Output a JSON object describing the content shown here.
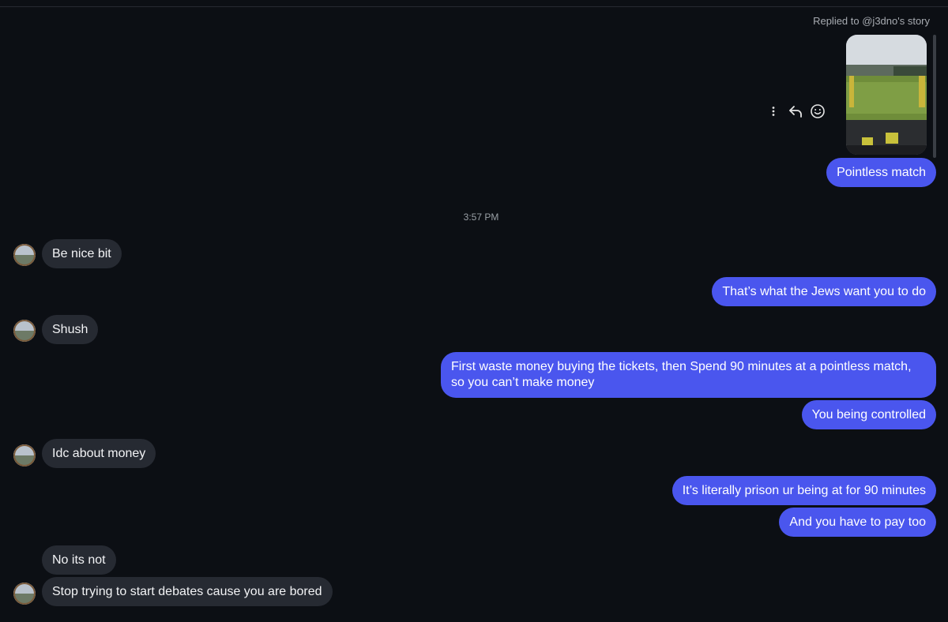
{
  "header": {
    "replied_label": "Replied to @j3dno's story"
  },
  "story": {
    "image_alt": "football stadium photo"
  },
  "actions": {
    "more_icon": "more-vertical-icon",
    "reply_icon": "reply-icon",
    "react_icon": "smiley-icon"
  },
  "timestamp": "3:57 PM",
  "messages": [
    {
      "side": "out",
      "text": "Pointless match"
    },
    {
      "side": "in",
      "text": "Be nice bit"
    },
    {
      "side": "out",
      "text": "That’s what the Jews want you to do"
    },
    {
      "side": "in",
      "text": "Shush"
    },
    {
      "side": "out",
      "text": "First waste money buying the tickets, then Spend 90 minutes at a pointless match, so you can’t make money"
    },
    {
      "side": "out",
      "text": "You being controlled"
    },
    {
      "side": "in",
      "text": "Idc about money"
    },
    {
      "side": "out",
      "text": "It’s literally prison ur being at for 90 minutes"
    },
    {
      "side": "out",
      "text": "And you have to pay too"
    },
    {
      "side": "in",
      "text": "No its not"
    },
    {
      "side": "in",
      "text": "Stop trying to start debates cause you are bored"
    }
  ],
  "colors": {
    "background": "#0c0f14",
    "outgoing_bubble": "#4a56ee",
    "incoming_bubble": "#262a32"
  }
}
